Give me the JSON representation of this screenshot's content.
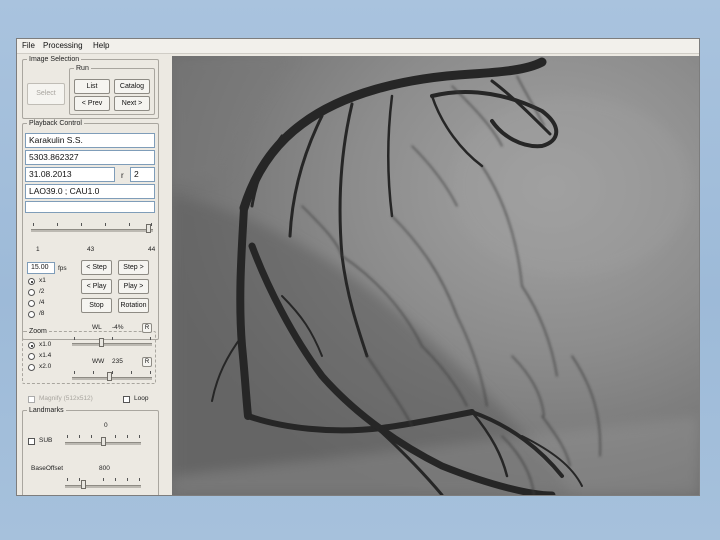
{
  "menu": {
    "file": "File",
    "processing": "Processing",
    "help": "Help"
  },
  "image_selection": {
    "legend": "Image Selection",
    "select_label": "Select",
    "run_legend": "Run",
    "list_label": "List",
    "catalog_label": "Catalog",
    "prev_label": "< Prev",
    "next_label": "Next >"
  },
  "playback": {
    "legend": "Playback Control",
    "patient_name": "Karakulin S.S.",
    "patient_id": "5303.862327",
    "date": "31.08.2013",
    "run_label": "r",
    "run_number": "2",
    "angles": "LAO39.0 ; CAU1.0",
    "extra_field": "",
    "frame_slider": {
      "min_label": "1",
      "current_label": "43",
      "max_label": "44",
      "position": 0.97
    },
    "fps_value": "15.00",
    "fps_unit": "fps",
    "speed_options": [
      "x1",
      "/2",
      "/4",
      "/8"
    ],
    "speed_selected": 0,
    "step_back": "< Step",
    "step_fwd": "Step >",
    "play_back": "< Play",
    "play_fwd": "Play >",
    "stop": "Stop",
    "rotation": "Rotation"
  },
  "zoom": {
    "legend": "Zoom",
    "options": [
      "x1.0",
      "x1.4",
      "x2.0"
    ],
    "selected": 0,
    "wl_label": "WL",
    "wl_value": "-4%",
    "r_label": "R",
    "ww_label": "WW",
    "ww_value": "235"
  },
  "magnify": {
    "label": "Magnify (512x512)",
    "loop_label": "Loop"
  },
  "landmarks": {
    "legend": "Landmarks",
    "sub_label": "SUB",
    "sub_value": "0",
    "base_offset_label": "BaseOffset",
    "base_offset_value": "800"
  },
  "viewer": {
    "name": "angiogram-frame"
  }
}
